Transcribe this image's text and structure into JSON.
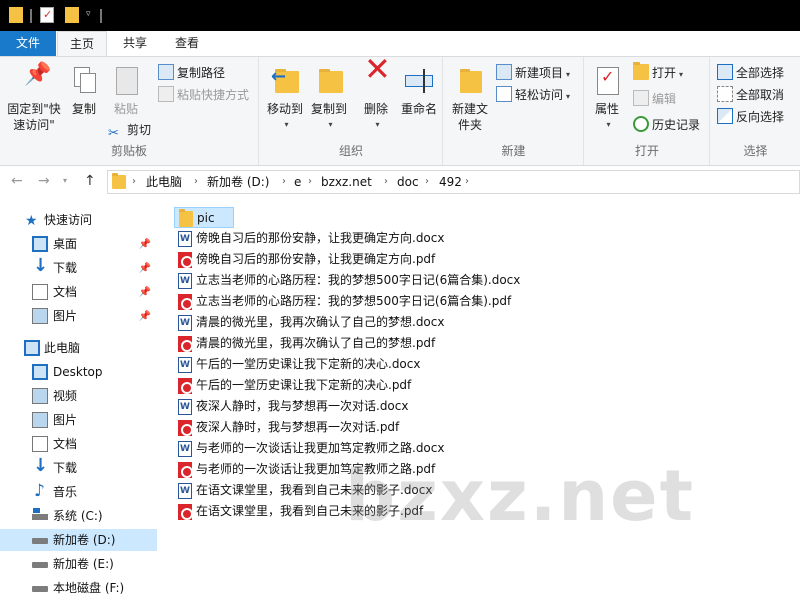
{
  "tabs": {
    "file": "文件",
    "home": "主页",
    "share": "共享",
    "view": "查看"
  },
  "ribbon": {
    "clipboard": {
      "label": "剪贴板",
      "pin_quick": "固定到\"快速访问\"",
      "copy": "复制",
      "paste": "粘贴",
      "copy_path": "复制路径",
      "paste_shortcut": "粘贴快捷方式",
      "cut": "剪切"
    },
    "organize": {
      "label": "组织",
      "move_to": "移动到",
      "copy_to": "复制到",
      "delete": "删除",
      "rename": "重命名"
    },
    "new": {
      "label": "新建",
      "new_folder": "新建文件夹",
      "new_item": "新建项目",
      "easy_access": "轻松访问"
    },
    "open": {
      "label": "打开",
      "properties": "属性",
      "open": "打开",
      "edit": "编辑",
      "history": "历史记录"
    },
    "select": {
      "label": "选择",
      "select_all": "全部选择",
      "select_none": "全部取消",
      "invert": "反向选择"
    }
  },
  "breadcrumb": [
    "此电脑",
    "新加卷 (D:)",
    "e",
    "bzxz.net",
    "doc",
    "492"
  ],
  "nav": {
    "quick_access": "快速访问",
    "quick_items": [
      "桌面",
      "下载",
      "文档",
      "图片"
    ],
    "this_pc": "此电脑",
    "pc_items": [
      "Desktop",
      "视频",
      "图片",
      "文档",
      "下载",
      "音乐",
      "系统 (C:)",
      "新加卷 (D:)",
      "新加卷 (E:)",
      "本地磁盘 (F:)"
    ]
  },
  "files": [
    {
      "name": "pic",
      "type": "folder"
    },
    {
      "name": "傍晚自习后的那份安静，让我更确定方向.docx",
      "type": "docx"
    },
    {
      "name": "傍晚自习后的那份安静，让我更确定方向.pdf",
      "type": "pdf"
    },
    {
      "name": "立志当老师的心路历程：我的梦想500字日记(6篇合集).docx",
      "type": "docx"
    },
    {
      "name": "立志当老师的心路历程：我的梦想500字日记(6篇合集).pdf",
      "type": "pdf"
    },
    {
      "name": "清晨的微光里，我再次确认了自己的梦想.docx",
      "type": "docx"
    },
    {
      "name": "清晨的微光里，我再次确认了自己的梦想.pdf",
      "type": "pdf"
    },
    {
      "name": "午后的一堂历史课让我下定新的决心.docx",
      "type": "docx"
    },
    {
      "name": "午后的一堂历史课让我下定新的决心.pdf",
      "type": "pdf"
    },
    {
      "name": "夜深人静时，我与梦想再一次对话.docx",
      "type": "docx"
    },
    {
      "name": "夜深人静时，我与梦想再一次对话.pdf",
      "type": "pdf"
    },
    {
      "name": "与老师的一次谈话让我更加笃定教师之路.docx",
      "type": "docx"
    },
    {
      "name": "与老师的一次谈话让我更加笃定教师之路.pdf",
      "type": "pdf"
    },
    {
      "name": "在语文课堂里，我看到自己未来的影子.docx",
      "type": "docx"
    },
    {
      "name": "在语文课堂里，我看到自己未来的影子.pdf",
      "type": "pdf"
    }
  ],
  "watermark": "bzxz.net",
  "colors": {
    "accent": "#1979ca",
    "selection": "#cce8ff",
    "folder": "#f5c244",
    "pdf": "#d9252b",
    "word": "#2a5699"
  }
}
